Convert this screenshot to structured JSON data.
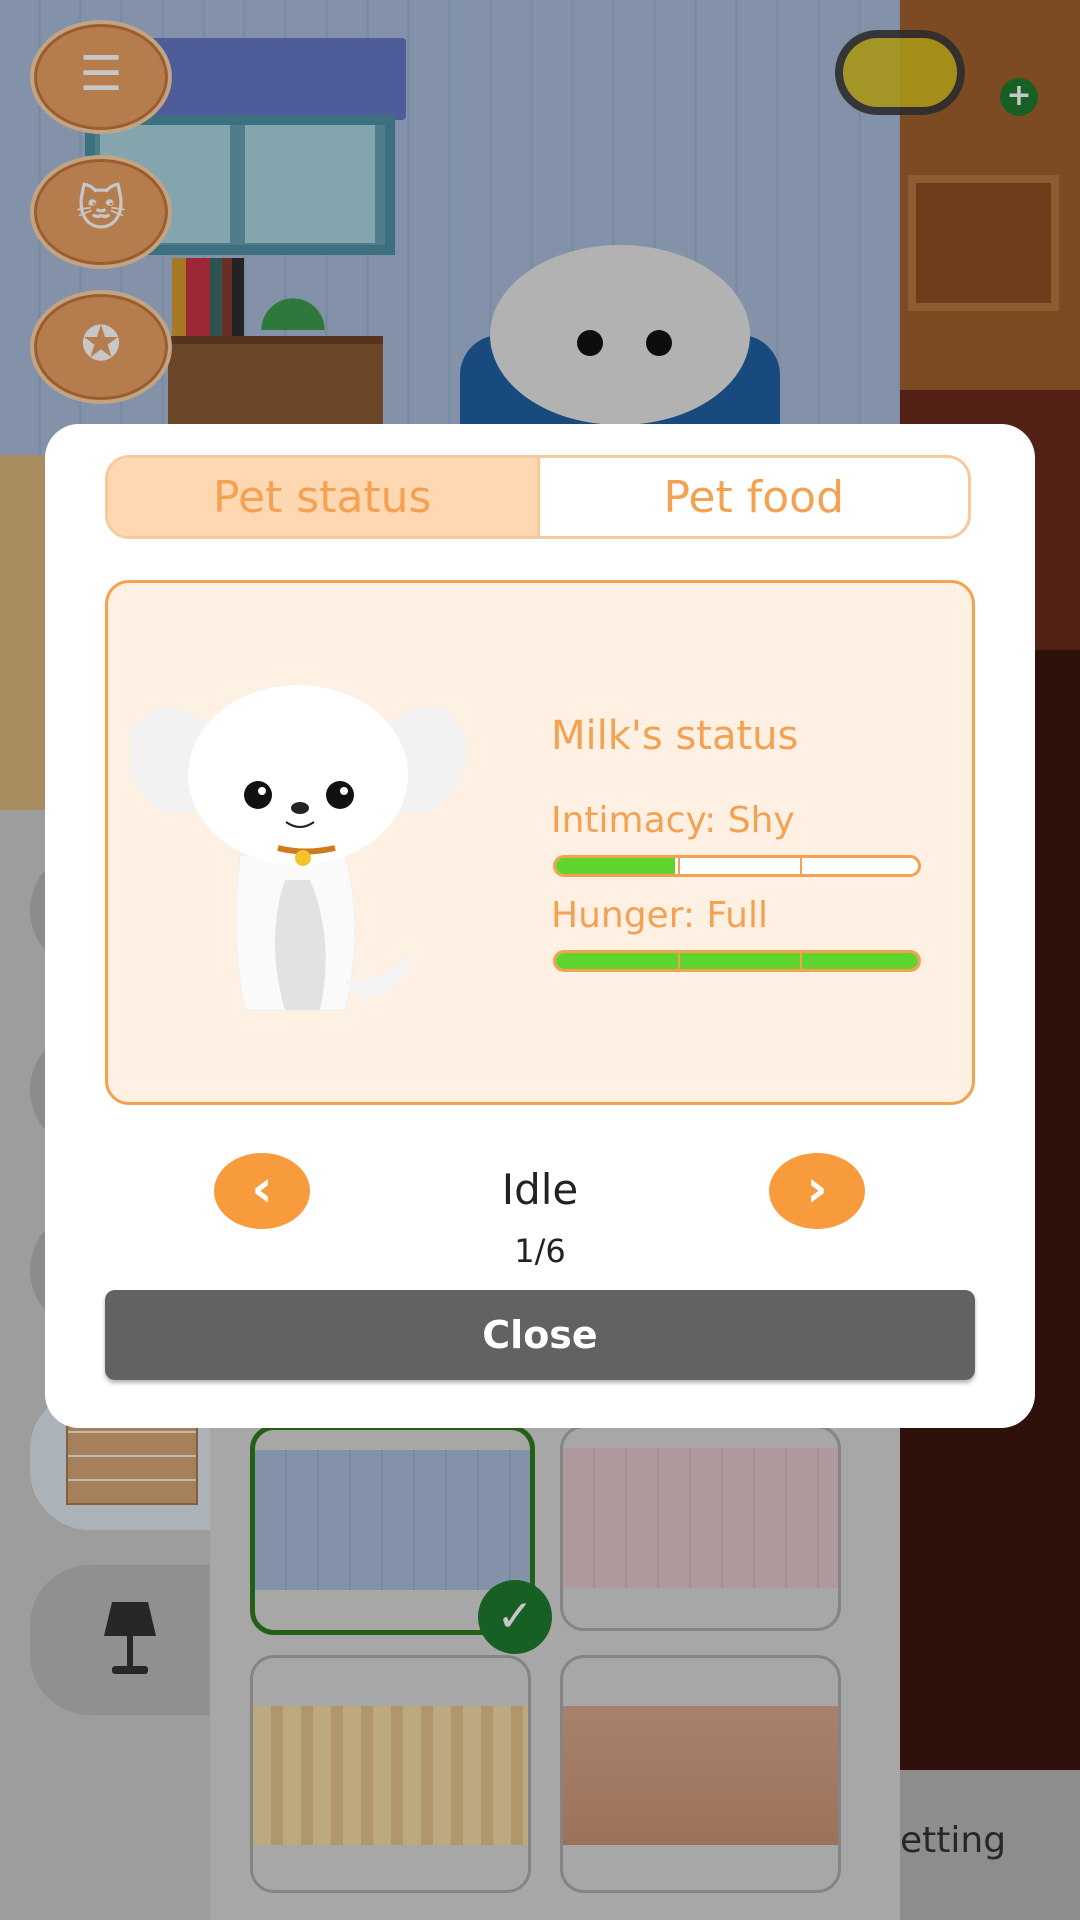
{
  "tabs": [
    {
      "label": "Pet status",
      "active": true
    },
    {
      "label": "Pet food",
      "active": false
    }
  ],
  "pet": {
    "status_title": "Milk's status",
    "intimacy_label": "Intimacy: Shy",
    "intimacy_level": 0.33,
    "hunger_label": "Hunger: Full",
    "hunger_level": 1.0
  },
  "animation": {
    "name": "Idle",
    "counter": "1/6"
  },
  "buttons": {
    "close_label": "Close",
    "prev_icon": "chevron-left-icon",
    "next_icon": "chevron-right-icon"
  },
  "side_buttons": [
    "list-icon",
    "cat-icon",
    "award-icon"
  ],
  "background": {
    "setting_label": "etting"
  },
  "colors": {
    "accent": "#f5a152",
    "bar_fill": "#5ed42c",
    "close_bg": "#626262",
    "selected_green": "#1f7a2e"
  }
}
